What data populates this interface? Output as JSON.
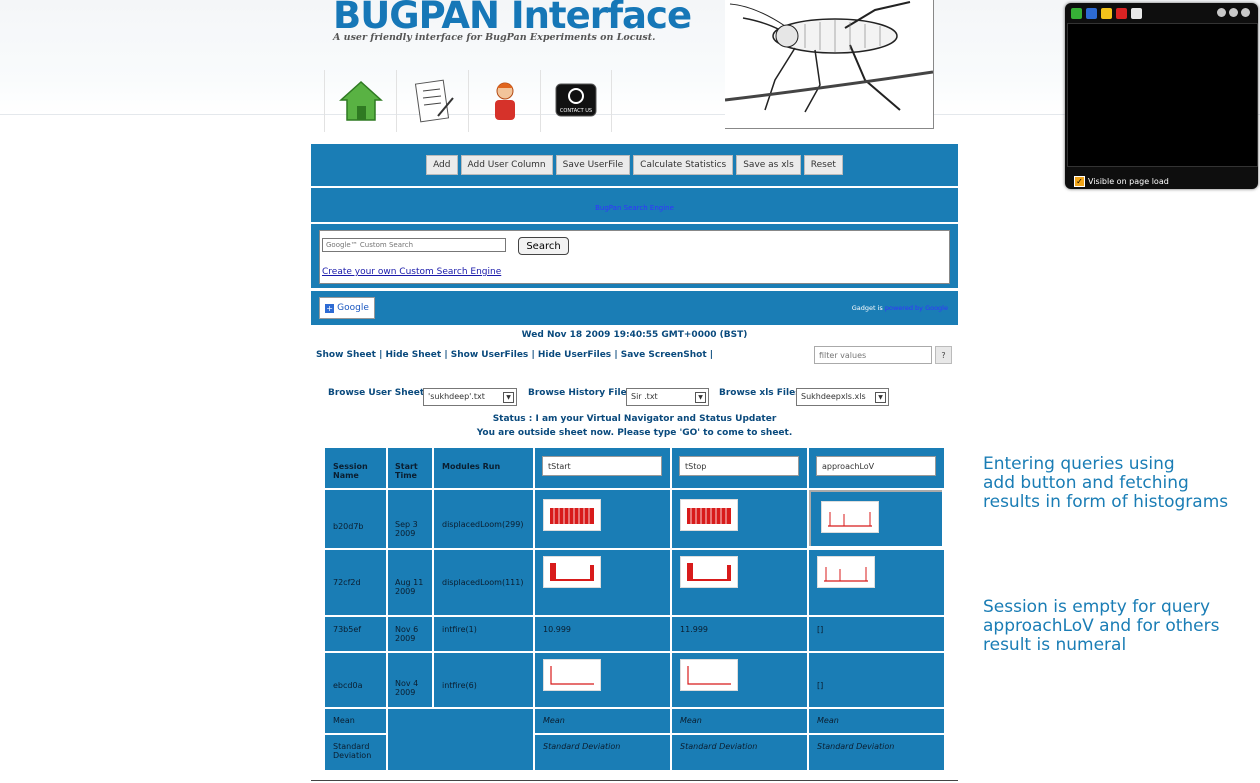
{
  "header": {
    "title": "BUGPAN Interface",
    "subtitle": "A user friendly interface for BugPan Experiments on Locust.",
    "nav": [
      {
        "icon": "home-icon"
      },
      {
        "icon": "document-list-icon"
      },
      {
        "icon": "person-icon"
      },
      {
        "icon": "contact-us-icon",
        "label": "CONTACT US"
      }
    ]
  },
  "widget": {
    "footer_label": "Visible on page load"
  },
  "toolbar": {
    "add": "Add",
    "add_user_column": "Add User Column",
    "save_userfile": "Save UserFile",
    "calculate_statistics": "Calculate Statistics",
    "save_as_xls": "Save as xls",
    "reset": "Reset"
  },
  "search": {
    "heading": "BugPan Search Engine",
    "placeholder": "Google™ Custom Search",
    "button": "Search",
    "create_link": "Create your own Custom Search Engine",
    "google_button": "Google",
    "gadget_prefix": "Gadget is ",
    "gadget_link": "powered by Google"
  },
  "datetime": "Wed Nov 18 2009 19:40:55 GMT+0000 (BST)",
  "links": {
    "show_sheet": "Show Sheet",
    "hide_sheet": "Hide Sheet",
    "show_userfiles": "Show UserFiles",
    "hide_userfiles": "Hide UserFiles",
    "save_screenshot": "Save ScreenShot",
    "sep": "|"
  },
  "filter": {
    "placeholder": "filter values",
    "help": "?"
  },
  "browse": {
    "user_sheets_label": "Browse User Sheets",
    "user_sheets_value": "'sukhdeep'.txt",
    "history_label": "Browse History Files",
    "history_value": "Sir .txt",
    "xls_label": "Browse xls Files",
    "xls_value": "Sukhdeepxls.xls"
  },
  "status": {
    "line1": "Status : I am your Virtual Navigator and Status Updater",
    "line2": "You are outside sheet now. Please type 'GO' to come to sheet."
  },
  "table": {
    "headers": {
      "session": "Session Name",
      "start": "Start Time",
      "modules": "Modules Run"
    },
    "queries": [
      "tStart",
      "tStop",
      "approachLoV"
    ],
    "rows": [
      {
        "session": "b20d7b",
        "start": "Sep 3 2009",
        "module": "displacedLoom(299)",
        "c1": "",
        "c2": "",
        "c3": ""
      },
      {
        "session": "72cf2d",
        "start": "Aug 11 2009",
        "module": "displacedLoom(111)",
        "c1": "",
        "c2": "",
        "c3": ""
      },
      {
        "session": "73b5ef",
        "start": "Nov 6 2009",
        "module": "intfire(1)",
        "c1": "10.999",
        "c2": "11.999",
        "c3": "[]"
      },
      {
        "session": "ebcd0a",
        "start": "Nov 4 2009",
        "module": "intfire(6)",
        "c1": "",
        "c2": "",
        "c3": "[]"
      }
    ],
    "mean_label": "Mean",
    "sd_label": "Standard Deviation",
    "mean_cells": [
      "Mean",
      "Mean",
      "Mean"
    ],
    "sd_cells": [
      "Standard Deviation",
      "Standard Deviation",
      "Standard Deviation"
    ]
  },
  "notes": {
    "note1": [
      "Entering queries using",
      "add button and fetching",
      "results in form of histograms"
    ],
    "note2": [
      "Session is empty for query",
      "approachLoV and for others",
      "result is numeral"
    ]
  },
  "colors": {
    "panel": "#1a7db5",
    "histogram": "#d81b1b"
  }
}
